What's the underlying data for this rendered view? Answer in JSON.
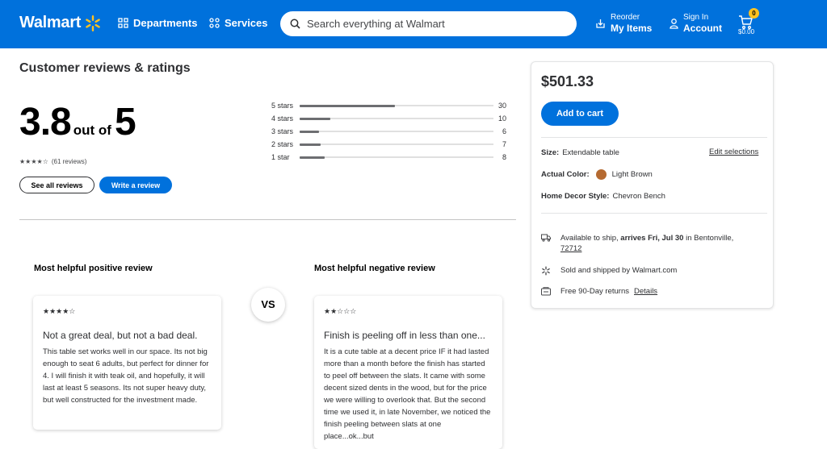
{
  "header": {
    "logo": "Walmart",
    "departments": "Departments",
    "services": "Services",
    "search_placeholder": "Search everything at Walmart",
    "reorder_small": "Reorder",
    "reorder_big": "My Items",
    "signin_small": "Sign In",
    "signin_big": "Account",
    "cart_count": "0",
    "cart_total": "$0.00",
    "accent": "#0071dc",
    "spark_color": "#ffc220"
  },
  "reviews": {
    "title": "Customer reviews & ratings",
    "rating": "3.8",
    "out_of": "out of",
    "max": "5",
    "stars_filled": 4,
    "review_count": "(61 reviews)",
    "see_all": "See all reviews",
    "write": "Write a review",
    "distribution": [
      {
        "label": "5 stars",
        "count": "30",
        "fraction": 0.49
      },
      {
        "label": "4 stars",
        "count": "10",
        "fraction": 0.16
      },
      {
        "label": "3 stars",
        "count": "6",
        "fraction": 0.1
      },
      {
        "label": "2 stars",
        "count": "7",
        "fraction": 0.11
      },
      {
        "label": "1 star",
        "count": "8",
        "fraction": 0.13
      }
    ],
    "positive": {
      "heading": "Most helpful positive review",
      "stars": 4,
      "title": "Not a great deal, but not a bad deal.",
      "body": "This table set works well in our space. Its not big enough to seat 6 adults, but perfect for dinner for 4. I will finish it with teak oil, and hopefully, it will last at least 5 seasons. Its not super heavy duty, but well constructed for the investment made."
    },
    "vs": "VS",
    "negative": {
      "heading": "Most helpful negative review",
      "stars": 2,
      "title": "Finish is peeling off in less than one...",
      "body": "It is a cute table at a decent price IF it had lasted more than a month before the finish has started to peel off between the slats. It came with some decent sized dents in the wood, but for the price we were willing to overlook that. But the second time we used it, in late November, we noticed the finish peeling between slats at one place...ok...but"
    }
  },
  "panel": {
    "price": "$501.33",
    "add_to_cart": "Add to cart",
    "size_label": "Size:",
    "size_value": "Extendable table",
    "edit": "Edit selections",
    "color_label": "Actual Color:",
    "color_value": "Light Brown",
    "color_swatch": "#b56a31",
    "style_label": "Home Decor Style:",
    "style_value": "Chevron Bench",
    "ship_pre": "Available to ship,",
    "ship_date": "arrives Fri, Jul 30",
    "ship_mid": "in Bentonville,",
    "ship_zip": "72712",
    "sold": "Sold and shipped by Walmart.com",
    "returns": "Free 90-Day returns",
    "details": "Details"
  }
}
